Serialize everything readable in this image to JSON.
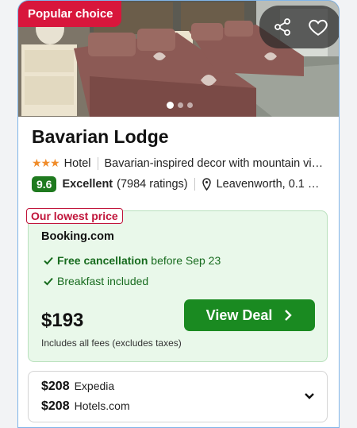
{
  "badge": "Popular choice",
  "icons": {
    "share": "share-icon",
    "favorite": "heart-icon",
    "check": "check-icon",
    "location": "location-pin-icon",
    "chevron_right": "chevron-right-icon",
    "chevron_down": "chevron-down-icon"
  },
  "carousel": {
    "count": 3,
    "active": 1
  },
  "hotel": {
    "name": "Bavarian Lodge",
    "stars": 3,
    "stars_glyph": "★★★",
    "type": "Hotel",
    "description": "Bavarian-inspired decor with mountain vi…",
    "score": "9.6",
    "rating_label": "Excellent",
    "rating_count": "(7984 ratings)",
    "location": "Leavenworth, 0.1 …"
  },
  "deal": {
    "tag": "Our lowest price",
    "provider": "Booking.com",
    "cancellation_bold": "Free cancellation",
    "cancellation_rest": "before Sep 23",
    "breakfast": "Breakfast included",
    "price": "$193",
    "fees_note": "Includes all fees (excludes taxes)",
    "button_label": "View Deal"
  },
  "other_prices": [
    {
      "price": "$208",
      "provider": "Expedia"
    },
    {
      "price": "$208",
      "provider": "Hotels.com"
    }
  ],
  "colors": {
    "badge": "#d8163c",
    "button": "#1a8a21",
    "score": "#1f7a1f",
    "stars": "#f08c2a",
    "deal_bg": "#e9f8ea"
  }
}
